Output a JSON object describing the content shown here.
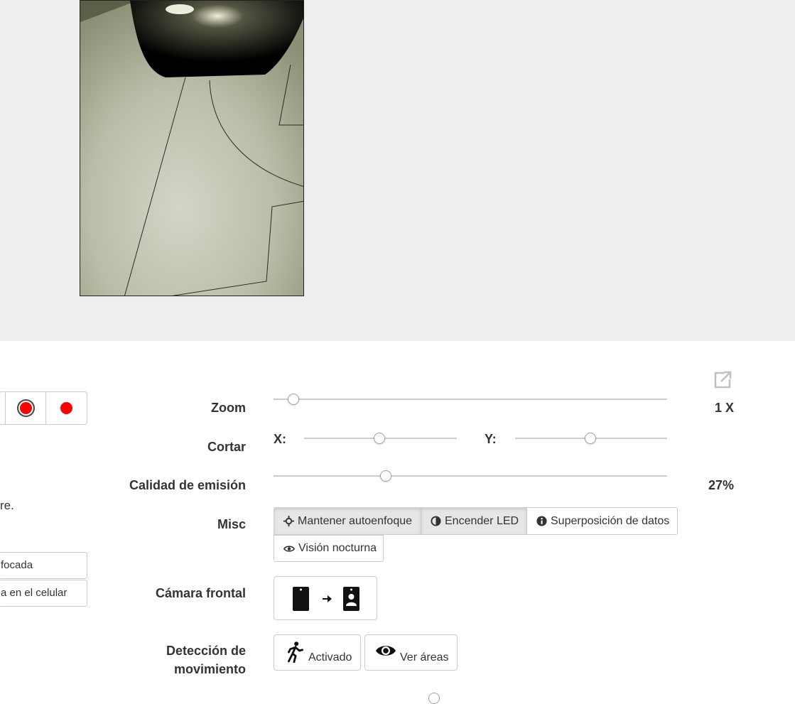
{
  "controls": {
    "zoom": {
      "label": "Zoom",
      "value_text": "1 X",
      "level": 0.05
    },
    "crop": {
      "label": "Cortar",
      "x_label": "X:",
      "y_label": "Y:",
      "x_level": 0.5,
      "y_level": 0.5
    },
    "quality": {
      "label": "Calidad de emisión",
      "value_text": "27%",
      "level": 0.29
    },
    "misc": {
      "label": "Misc",
      "autofocus": "Mantener autoenfoque",
      "led": "Encender LED",
      "overlay": "Superposición de datos",
      "night": "Visión nocturna"
    },
    "front_camera": {
      "label": "Cámara frontal"
    },
    "motion": {
      "label_line1": "Detección de",
      "label_line2": "movimiento",
      "activated": "Activado",
      "view_areas": "Ver áreas"
    }
  },
  "left_panel": {
    "text_fragment": "re.",
    "input1_text": "focada",
    "input2_text": "a en el celular"
  },
  "colors": {
    "record_red": "#ff0000",
    "video_bg": "#eeeeee",
    "border": "#cccccc",
    "active_bg": "#e6e6e6"
  },
  "icons": [
    "popout-icon",
    "crosshair-icon",
    "contrast-icon",
    "info-icon",
    "eye-icon",
    "switch-camera-icon",
    "running-person-icon"
  ]
}
